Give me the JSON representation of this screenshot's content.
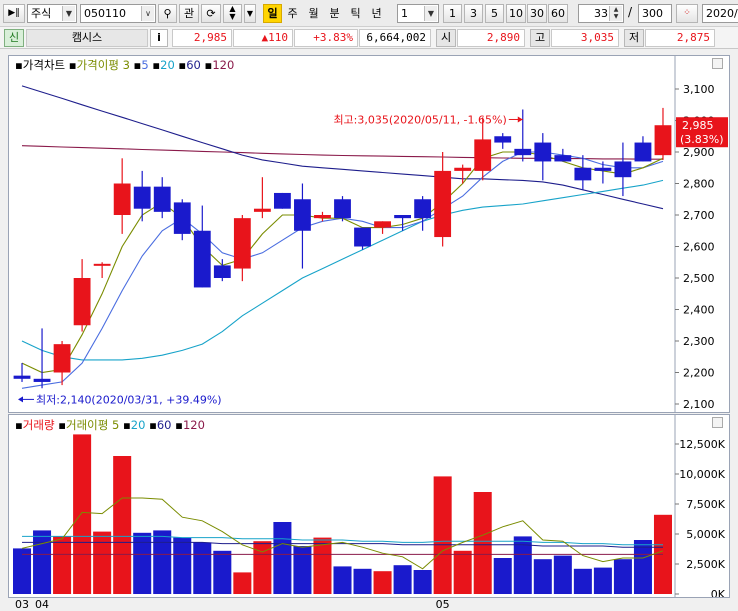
{
  "toolbar": {
    "market_type": "주식",
    "stock_code": "050110",
    "btn_gwan": "관",
    "period_buttons": [
      {
        "label": "일",
        "active": true
      },
      {
        "label": "주",
        "active": false
      },
      {
        "label": "월",
        "active": false
      },
      {
        "label": "분",
        "active": false
      },
      {
        "label": "틱",
        "active": false
      },
      {
        "label": "년",
        "active": false
      }
    ],
    "interval_value": "1",
    "interval_buttons": [
      "1",
      "3",
      "5",
      "10",
      "30",
      "60"
    ],
    "count_value": "33",
    "count_separator": "/",
    "count_total": "300",
    "date_value": "2020/"
  },
  "price_row": {
    "badge": "신",
    "stock_name": "캠시스",
    "info_button": "i",
    "current_price": "2,985",
    "change": "▲110",
    "change_rate": "+3.83%",
    "volume": "6,664,002",
    "open_label": "시",
    "open": "2,890",
    "high_label": "고",
    "high": "3,035",
    "low_label": "저",
    "low": "2,875"
  },
  "price_pane": {
    "legend": {
      "title": "가격차트",
      "ma_title": "가격이평",
      "periods": [
        "3",
        "5",
        "20",
        "60",
        "120"
      ]
    },
    "high_annotation": "최고:3,035(2020/05/11, -1.65%)",
    "low_annotation": "최저:2,140(2020/03/31, +39.49%)",
    "current_label": "2,985",
    "current_rate_label": "(3.83%)",
    "y_ticks": [
      2100,
      2200,
      2300,
      2400,
      2500,
      2600,
      2700,
      2800,
      2900,
      3000,
      3100
    ],
    "y_tick_labels": [
      "2,100",
      "2,200",
      "2,300",
      "2,400",
      "2,500",
      "2,600",
      "2,700",
      "2,800",
      "2,900",
      "3,000",
      "3,100"
    ]
  },
  "volume_pane": {
    "legend": {
      "title": "거래량",
      "ma_title": "거래이평",
      "periods": [
        "5",
        "20",
        "60",
        "120"
      ]
    },
    "y_ticks": [
      0,
      2500,
      5000,
      7500,
      10000,
      12500
    ],
    "y_tick_labels": [
      "0K",
      "2,500K",
      "5,000K",
      "7,500K",
      "10,000K",
      "12,500K"
    ],
    "x_labels": [
      {
        "text": "03",
        "index": 0
      },
      {
        "text": "04",
        "index": 1
      },
      {
        "text": "05",
        "index": 21
      }
    ]
  },
  "colors": {
    "up": "#e8141b",
    "down": "#1a1acc",
    "ma3": "#7a8c00",
    "ma5": "#4a6de0",
    "ma20": "#17a3c9",
    "ma60": "#1e1e8c",
    "ma120": "#8a1a4a"
  },
  "chart_data": {
    "type": "candlestick",
    "unit_price": "KRW",
    "unit_volume": "K shares",
    "candles": [
      {
        "o": 2190,
        "h": 2230,
        "l": 2170,
        "c": 2180,
        "v": 3800
      },
      {
        "o": 2180,
        "h": 2340,
        "l": 2150,
        "c": 2170,
        "v": 5300
      },
      {
        "o": 2200,
        "h": 2300,
        "l": 2160,
        "c": 2290,
        "v": 4800
      },
      {
        "o": 2350,
        "h": 2560,
        "l": 2330,
        "c": 2500,
        "v": 13300
      },
      {
        "o": 2540,
        "h": 2550,
        "l": 2500,
        "c": 2545,
        "v": 5200
      },
      {
        "o": 2700,
        "h": 2880,
        "l": 2640,
        "c": 2800,
        "v": 11500
      },
      {
        "o": 2790,
        "h": 2840,
        "l": 2680,
        "c": 2720,
        "v": 5100
      },
      {
        "o": 2790,
        "h": 2820,
        "l": 2690,
        "c": 2710,
        "v": 5300
      },
      {
        "o": 2740,
        "h": 2750,
        "l": 2620,
        "c": 2640,
        "v": 4700
      },
      {
        "o": 2650,
        "h": 2730,
        "l": 2470,
        "c": 2470,
        "v": 4300
      },
      {
        "o": 2540,
        "h": 2560,
        "l": 2490,
        "c": 2500,
        "v": 3600
      },
      {
        "o": 2530,
        "h": 2700,
        "l": 2490,
        "c": 2690,
        "v": 1800
      },
      {
        "o": 2710,
        "h": 2820,
        "l": 2690,
        "c": 2720,
        "v": 4400
      },
      {
        "o": 2770,
        "h": 2770,
        "l": 2720,
        "c": 2720,
        "v": 6000
      },
      {
        "o": 2750,
        "h": 2800,
        "l": 2530,
        "c": 2650,
        "v": 4000
      },
      {
        "o": 2690,
        "h": 2710,
        "l": 2680,
        "c": 2700,
        "v": 4700
      },
      {
        "o": 2750,
        "h": 2760,
        "l": 2680,
        "c": 2690,
        "v": 2300
      },
      {
        "o": 2660,
        "h": 2660,
        "l": 2590,
        "c": 2600,
        "v": 2100
      },
      {
        "o": 2660,
        "h": 2680,
        "l": 2640,
        "c": 2680,
        "v": 1900
      },
      {
        "o": 2700,
        "h": 2700,
        "l": 2650,
        "c": 2690,
        "v": 2400
      },
      {
        "o": 2750,
        "h": 2760,
        "l": 2650,
        "c": 2690,
        "v": 2000
      },
      {
        "o": 2630,
        "h": 2900,
        "l": 2600,
        "c": 2840,
        "v": 9800
      },
      {
        "o": 2840,
        "h": 2860,
        "l": 2800,
        "c": 2850,
        "v": 3600
      },
      {
        "o": 2840,
        "h": 3010,
        "l": 2810,
        "c": 2940,
        "v": 8500
      },
      {
        "o": 2950,
        "h": 2960,
        "l": 2910,
        "c": 2930,
        "v": 3000
      },
      {
        "o": 2910,
        "h": 3035,
        "l": 2870,
        "c": 2890,
        "v": 4800
      },
      {
        "o": 2930,
        "h": 2960,
        "l": 2810,
        "c": 2870,
        "v": 2900
      },
      {
        "o": 2890,
        "h": 2910,
        "l": 2870,
        "c": 2870,
        "v": 3200
      },
      {
        "o": 2850,
        "h": 2890,
        "l": 2780,
        "c": 2810,
        "v": 2100
      },
      {
        "o": 2850,
        "h": 2870,
        "l": 2800,
        "c": 2840,
        "v": 2200
      },
      {
        "o": 2870,
        "h": 2930,
        "l": 2760,
        "c": 2820,
        "v": 2900
      },
      {
        "o": 2930,
        "h": 2950,
        "l": 2870,
        "c": 2870,
        "v": 4500
      },
      {
        "o": 2890,
        "h": 3040,
        "l": 2875,
        "c": 2985,
        "v": 6600
      }
    ],
    "ma": {
      "3": [
        2230,
        2200,
        2210,
        2320,
        2450,
        2600,
        2700,
        2740,
        2690,
        2600,
        2540,
        2560,
        2640,
        2700,
        2700,
        2690,
        2690,
        2660,
        2660,
        2670,
        2690,
        2740,
        2800,
        2880,
        2900,
        2900,
        2890,
        2870,
        2850,
        2840,
        2830,
        2850,
        2880
      ],
      "5": [
        2150,
        2160,
        2170,
        2230,
        2340,
        2460,
        2570,
        2650,
        2690,
        2640,
        2580,
        2560,
        2580,
        2620,
        2660,
        2680,
        2690,
        2680,
        2660,
        2660,
        2680,
        2720,
        2760,
        2820,
        2870,
        2900,
        2900,
        2890,
        2880,
        2860,
        2850,
        2850,
        2870
      ],
      "20": [
        2300,
        2270,
        2250,
        2240,
        2240,
        2240,
        2245,
        2255,
        2270,
        2290,
        2330,
        2380,
        2420,
        2460,
        2500,
        2530,
        2560,
        2590,
        2620,
        2650,
        2680,
        2700,
        2715,
        2725,
        2730,
        2735,
        2745,
        2755,
        2765,
        2775,
        2785,
        2795,
        2810
      ],
      "60": [
        3110,
        3090,
        3070,
        3050,
        3030,
        3010,
        2990,
        2970,
        2950,
        2930,
        2910,
        2890,
        2875,
        2865,
        2855,
        2850,
        2845,
        2840,
        2835,
        2830,
        2825,
        2820,
        2815,
        2815,
        2812,
        2810,
        2805,
        2795,
        2780,
        2765,
        2750,
        2735,
        2720
      ],
      "120": [
        2920,
        2918,
        2916,
        2914,
        2912,
        2910,
        2908,
        2906,
        2904,
        2902,
        2900,
        2898,
        2896,
        2894,
        2892,
        2890,
        2889,
        2888,
        2887,
        2886,
        2885,
        2884,
        2883,
        2882,
        2881,
        2880,
        2880,
        2879,
        2879,
        2878,
        2878,
        2877,
        2877
      ]
    },
    "vol_ma": {
      "5": [
        3800,
        4200,
        4600,
        6800,
        6700,
        8000,
        8000,
        7900,
        6400,
        6100,
        5200,
        4100,
        3500,
        4200,
        3900,
        4100,
        4300,
        3900,
        3400,
        3100,
        2100,
        3600,
        4300,
        4900,
        5600,
        6100,
        4500,
        4400,
        3200,
        2700,
        3000,
        3000,
        3600
      ],
      "20": [
        4800,
        4800,
        4800,
        4800,
        4800,
        4800,
        4800,
        4800,
        4700,
        4700,
        4700,
        4600,
        4600,
        4600,
        4500,
        4500,
        4500,
        4400,
        4400,
        4300,
        4300,
        4400,
        4400,
        4400,
        4400,
        4400,
        4300,
        4300,
        4200,
        4200,
        4100,
        4100,
        4100
      ],
      "60": [
        4300,
        4300,
        4300,
        4300,
        4300,
        4300,
        4300,
        4300,
        4300,
        4300,
        4200,
        4200,
        4200,
        4200,
        4200,
        4200,
        4200,
        4200,
        4200,
        4100,
        4100,
        4100,
        4100,
        4100,
        4100,
        4100,
        4000,
        4000,
        4000,
        4000,
        3900,
        3900,
        3900
      ],
      "120": [
        3300,
        3300,
        3300,
        3300,
        3300,
        3300,
        3300,
        3300,
        3300,
        3300,
        3300,
        3300,
        3300,
        3300,
        3300,
        3300,
        3300,
        3300,
        3300,
        3300,
        3300,
        3300,
        3300,
        3300,
        3300,
        3300,
        3300,
        3300,
        3300,
        3300,
        3300,
        3300,
        3300
      ]
    }
  }
}
